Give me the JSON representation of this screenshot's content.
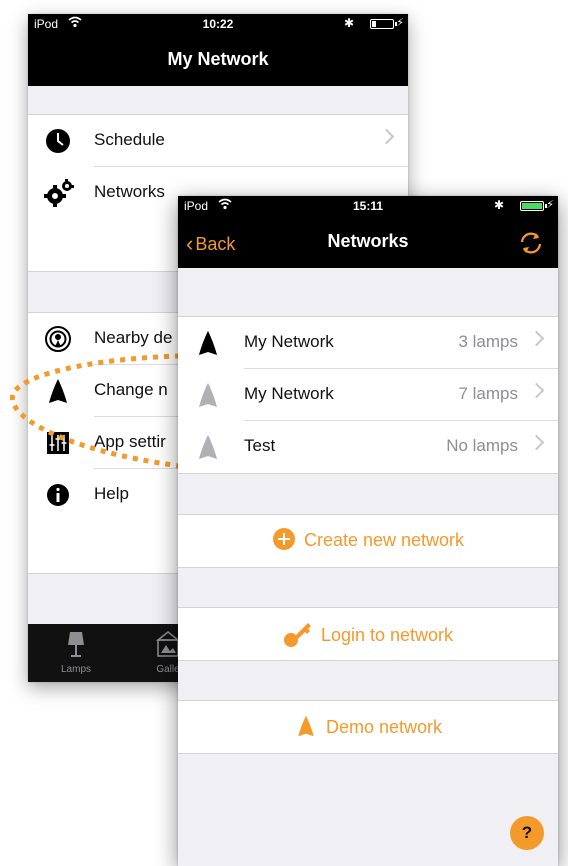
{
  "colors": {
    "accent": "#f39a2b",
    "black": "#000000",
    "gray_lamp": "#b0b0b5"
  },
  "back_screen": {
    "status": {
      "carrier": "iPod",
      "time": "10:22"
    },
    "title": "My Network",
    "items": [
      {
        "label": "Schedule",
        "icon": "clock-icon"
      },
      {
        "label": "Networks",
        "icon": "gears-icon"
      },
      {
        "label": "Nearby de",
        "icon": "broadcast-icon"
      },
      {
        "label": "Change n",
        "icon": "lamp-icon"
      },
      {
        "label": "App settir",
        "icon": "sliders-icon"
      },
      {
        "label": "Help",
        "icon": "info-icon"
      }
    ],
    "tabs": [
      {
        "label": "Lamps",
        "icon": "lamp-tab-icon"
      },
      {
        "label": "Galle",
        "icon": "gallery-icon"
      }
    ]
  },
  "front_screen": {
    "status": {
      "carrier": "iPod",
      "time": "15:11"
    },
    "back_label": "Back",
    "title": "Networks",
    "networks": [
      {
        "name": "My Network",
        "lamps": "3 lamps",
        "active": true
      },
      {
        "name": "My Network",
        "lamps": "7 lamps",
        "active": false
      },
      {
        "name": "Test",
        "lamps": "No lamps",
        "active": false
      }
    ],
    "actions": {
      "create": "Create new network",
      "login": "Login to network",
      "demo": "Demo network"
    },
    "help": "?"
  }
}
